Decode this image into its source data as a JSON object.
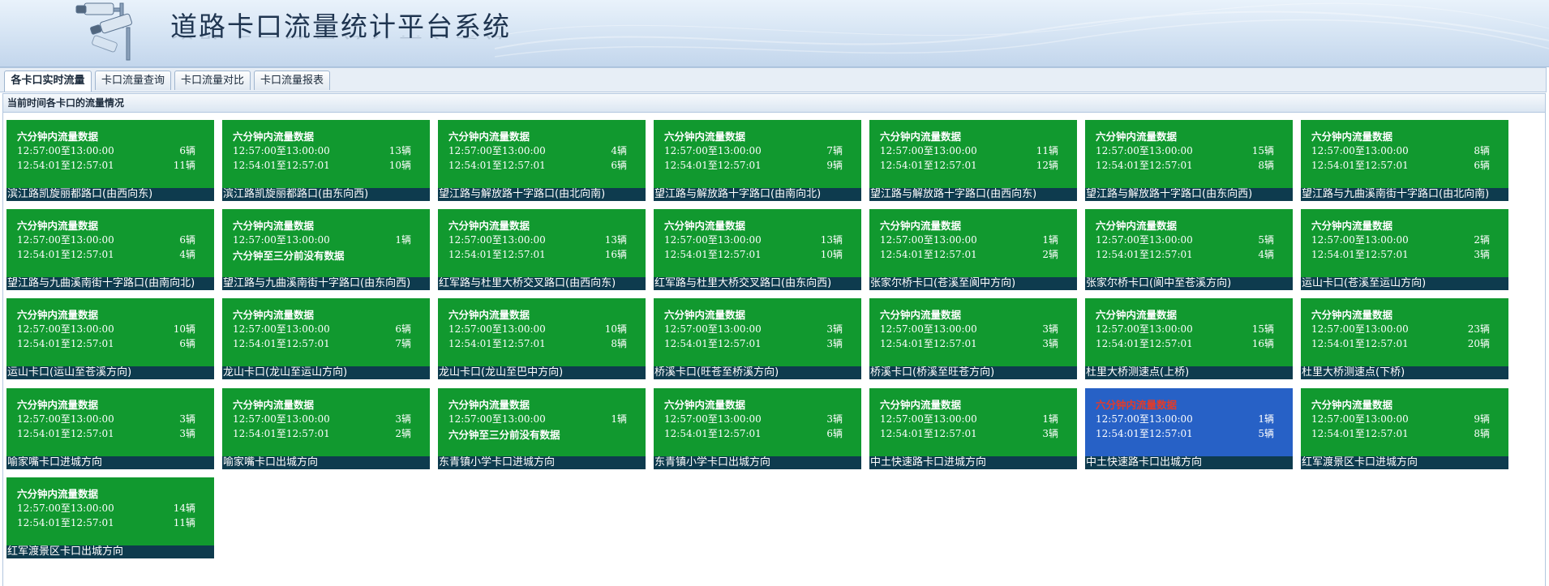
{
  "header": {
    "title": "道路卡口流量统计平台系统"
  },
  "tabs": [
    {
      "label": "各卡口实时流量"
    },
    {
      "label": "卡口流量查询"
    },
    {
      "label": "卡口流量对比"
    },
    {
      "label": "卡口流量报表"
    }
  ],
  "subheader": "当前时间各卡口的流量情况",
  "card_title": "六分钟内流量数据",
  "cards": [
    {
      "name": "滨江路凯旋丽都路口(由西向东)",
      "r1_time": "12:57:00至13:00:00",
      "r1_count": "6辆",
      "r2_time": "12:54:01至12:57:01",
      "r2_count": "11辆"
    },
    {
      "name": "滨江路凯旋丽都路口(由东向西)",
      "r1_time": "12:57:00至13:00:00",
      "r1_count": "13辆",
      "r2_time": "12:54:01至12:57:01",
      "r2_count": "10辆"
    },
    {
      "name": "望江路与解放路十字路口(由北向南)",
      "r1_time": "12:57:00至13:00:00",
      "r1_count": "4辆",
      "r2_time": "12:54:01至12:57:01",
      "r2_count": "6辆"
    },
    {
      "name": "望江路与解放路十字路口(由南向北)",
      "r1_time": "12:57:00至13:00:00",
      "r1_count": "7辆",
      "r2_time": "12:54:01至12:57:01",
      "r2_count": "9辆"
    },
    {
      "name": "望江路与解放路十字路口(由西向东)",
      "r1_time": "12:57:00至13:00:00",
      "r1_count": "11辆",
      "r2_time": "12:54:01至12:57:01",
      "r2_count": "12辆"
    },
    {
      "name": "望江路与解放路十字路口(由东向西)",
      "r1_time": "12:57:00至13:00:00",
      "r1_count": "15辆",
      "r2_time": "12:54:01至12:57:01",
      "r2_count": "8辆"
    },
    {
      "name": "望江路与九曲溪南街十字路口(由北向南)",
      "r1_time": "12:57:00至13:00:00",
      "r1_count": "8辆",
      "r2_time": "12:54:01至12:57:01",
      "r2_count": "6辆"
    },
    {
      "name": "望江路与九曲溪南街十字路口(由南向北)",
      "r1_time": "12:57:00至13:00:00",
      "r1_count": "6辆",
      "r2_time": "12:54:01至12:57:01",
      "r2_count": "4辆"
    },
    {
      "name": "望江路与九曲溪南街十字路口(由东向西)",
      "r1_time": "12:57:00至13:00:00",
      "r1_count": "1辆",
      "r2_time": "六分钟至三分前没有数据",
      "r2_count": ""
    },
    {
      "name": "红军路与杜里大桥交叉路口(由西向东)",
      "r1_time": "12:57:00至13:00:00",
      "r1_count": "13辆",
      "r2_time": "12:54:01至12:57:01",
      "r2_count": "16辆"
    },
    {
      "name": "红军路与杜里大桥交叉路口(由东向西)",
      "r1_time": "12:57:00至13:00:00",
      "r1_count": "13辆",
      "r2_time": "12:54:01至12:57:01",
      "r2_count": "10辆"
    },
    {
      "name": "张家尔桥卡口(苍溪至阆中方向)",
      "r1_time": "12:57:00至13:00:00",
      "r1_count": "1辆",
      "r2_time": "12:54:01至12:57:01",
      "r2_count": "2辆"
    },
    {
      "name": "张家尔桥卡口(阆中至苍溪方向)",
      "r1_time": "12:57:00至13:00:00",
      "r1_count": "5辆",
      "r2_time": "12:54:01至12:57:01",
      "r2_count": "4辆"
    },
    {
      "name": "运山卡口(苍溪至运山方向)",
      "r1_time": "12:57:00至13:00:00",
      "r1_count": "2辆",
      "r2_time": "12:54:01至12:57:01",
      "r2_count": "3辆"
    },
    {
      "name": "运山卡口(运山至苍溪方向)",
      "r1_time": "12:57:00至13:00:00",
      "r1_count": "10辆",
      "r2_time": "12:54:01至12:57:01",
      "r2_count": "6辆"
    },
    {
      "name": "龙山卡口(龙山至运山方向)",
      "r1_time": "12:57:00至13:00:00",
      "r1_count": "6辆",
      "r2_time": "12:54:01至12:57:01",
      "r2_count": "7辆"
    },
    {
      "name": "龙山卡口(龙山至巴中方向)",
      "r1_time": "12:57:00至13:00:00",
      "r1_count": "10辆",
      "r2_time": "12:54:01至12:57:01",
      "r2_count": "8辆"
    },
    {
      "name": "桥溪卡口(旺苍至桥溪方向)",
      "r1_time": "12:57:00至13:00:00",
      "r1_count": "3辆",
      "r2_time": "12:54:01至12:57:01",
      "r2_count": "3辆"
    },
    {
      "name": "桥溪卡口(桥溪至旺苍方向)",
      "r1_time": "12:57:00至13:00:00",
      "r1_count": "3辆",
      "r2_time": "12:54:01至12:57:01",
      "r2_count": "3辆"
    },
    {
      "name": "杜里大桥测速点(上桥)",
      "r1_time": "12:57:00至13:00:00",
      "r1_count": "15辆",
      "r2_time": "12:54:01至12:57:01",
      "r2_count": "16辆"
    },
    {
      "name": "杜里大桥测速点(下桥)",
      "r1_time": "12:57:00至13:00:00",
      "r1_count": "23辆",
      "r2_time": "12:54:01至12:57:01",
      "r2_count": "20辆"
    },
    {
      "name": "喻家嘴卡口进城方向",
      "r1_time": "12:57:00至13:00:00",
      "r1_count": "3辆",
      "r2_time": "12:54:01至12:57:01",
      "r2_count": "3辆"
    },
    {
      "name": "喻家嘴卡口出城方向",
      "r1_time": "12:57:00至13:00:00",
      "r1_count": "3辆",
      "r2_time": "12:54:01至12:57:01",
      "r2_count": "2辆"
    },
    {
      "name": "东青镇小学卡口进城方向",
      "r1_time": "12:57:00至13:00:00",
      "r1_count": "1辆",
      "r2_time": "六分钟至三分前没有数据",
      "r2_count": ""
    },
    {
      "name": "东青镇小学卡口出城方向",
      "r1_time": "12:57:00至13:00:00",
      "r1_count": "3辆",
      "r2_time": "12:54:01至12:57:01",
      "r2_count": "6辆"
    },
    {
      "name": "中土快速路卡口进城方向",
      "r1_time": "12:57:00至13:00:00",
      "r1_count": "1辆",
      "r2_time": "12:54:01至12:57:01",
      "r2_count": "3辆"
    },
    {
      "name": "中土快速路卡口出城方向",
      "r1_time": "12:57:00至13:00:00",
      "r1_count": "1辆",
      "r2_time": "12:54:01至12:57:01",
      "r2_count": "5辆",
      "selected": true
    },
    {
      "name": "红军渡景区卡口进城方向",
      "r1_time": "12:57:00至13:00:00",
      "r1_count": "9辆",
      "r2_time": "12:54:01至12:57:01",
      "r2_count": "8辆"
    },
    {
      "name": "红军渡景区卡口出城方向",
      "r1_time": "12:57:00至13:00:00",
      "r1_count": "14辆",
      "r2_time": "12:54:01至12:57:01",
      "r2_count": "11辆"
    }
  ],
  "colors": {
    "card_green": "#11992f",
    "card_selected": "#2761c6",
    "name_bar": "#0e3b4e",
    "selected_title": "#e23b2a"
  },
  "icons": [
    "surveillance-camera-icon"
  ]
}
